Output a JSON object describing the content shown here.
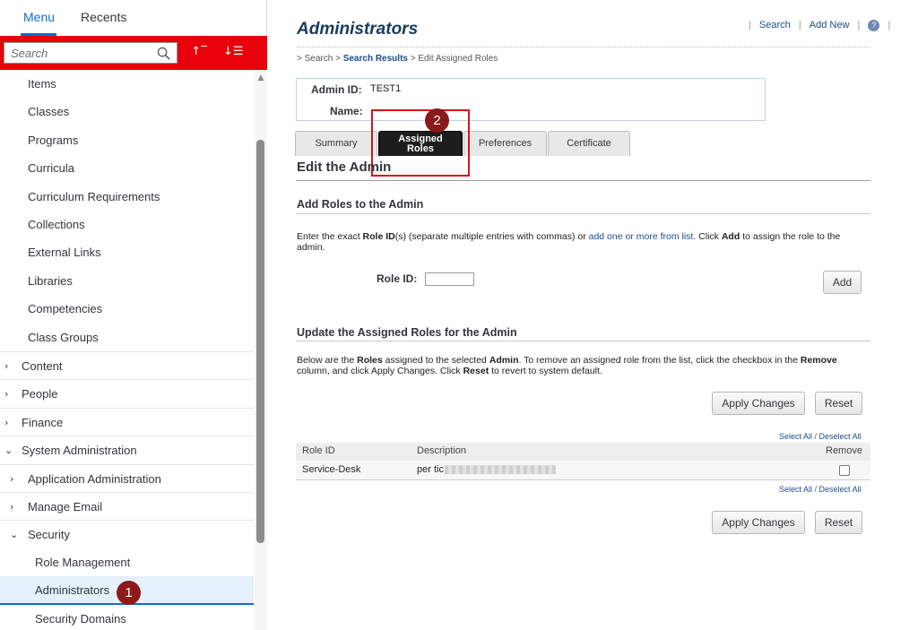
{
  "sidebar": {
    "tabs": [
      {
        "label": "Menu"
      },
      {
        "label": "Recents"
      }
    ],
    "search": {
      "placeholder": "Search",
      "value": ""
    },
    "tools": {
      "collapse_icon": "↑‾",
      "sort_icon": "↓☰"
    },
    "items": [
      {
        "label": "Items"
      },
      {
        "label": "Classes"
      },
      {
        "label": "Programs"
      },
      {
        "label": "Curricula"
      },
      {
        "label": "Curriculum Requirements"
      },
      {
        "label": "Collections"
      },
      {
        "label": "External Links"
      },
      {
        "label": "Libraries"
      },
      {
        "label": "Competencies"
      },
      {
        "label": "Class Groups"
      },
      {
        "label": "Content"
      },
      {
        "label": "People"
      },
      {
        "label": "Finance"
      },
      {
        "label": "System Administration"
      },
      {
        "label": "Application Administration"
      },
      {
        "label": "Manage Email"
      },
      {
        "label": "Security"
      },
      {
        "label": "Role Management"
      },
      {
        "label": "Administrators"
      },
      {
        "label": "Security Domains"
      }
    ],
    "chevron_right": "›",
    "chevron_down": "⌄",
    "scroll_up_glyph": "▲"
  },
  "badges": {
    "one": "1",
    "two": "2"
  },
  "header": {
    "title": "Administrators",
    "links": {
      "search": "Search",
      "add_new": "Add New",
      "help": "?",
      "sep": "|"
    }
  },
  "breadcrumb": {
    "prefix": "> Search > ",
    "results": "Search Results",
    "suffix": " > Edit Assigned Roles"
  },
  "admin": {
    "id_label": "Admin ID:",
    "id_value": "TEST1",
    "name_label": "Name:",
    "name_value": ""
  },
  "tabs": [
    {
      "label": "Summary"
    },
    {
      "label": "Assigned Roles"
    },
    {
      "label": "Preferences"
    },
    {
      "label": "Certificate"
    }
  ],
  "tab_assigned_line1": "Assigned",
  "tab_assigned_line2": "Roles",
  "edit_title": "Edit the Admin",
  "add_section": {
    "title": "Add Roles to the Admin",
    "text_1": "Enter the exact ",
    "text_role_id": "Role ID",
    "text_2": "(s) (separate multiple entries with commas) or ",
    "link": "add one or more from list",
    "text_3": ". Click ",
    "text_add": "Add",
    "text_4": " to assign the role to the admin.",
    "role_label": "Role ID:",
    "role_value": "",
    "add_button": "Add"
  },
  "update_section": {
    "title": "Update the Assigned Roles for the Admin",
    "t1": "Below are the ",
    "t_roles": "Roles",
    "t2": " assigned to the selected ",
    "t_admin": "Admin",
    "t3": ". To remove an assigned role from the list, click the checkbox in the ",
    "t_remove": "Remove",
    "t4": " column, and click Apply Changes. Click ",
    "t_reset": "Reset",
    "t5": " to revert to system default.",
    "apply_button": "Apply Changes",
    "reset_button": "Reset",
    "select_all": "Select All",
    "deselect_all": "Deselect All",
    "slash": " / "
  },
  "table": {
    "headers": {
      "role_id": "Role ID",
      "description": "Description",
      "remove": "Remove"
    },
    "rows": [
      {
        "role_id": "Service-Desk",
        "description": "per tic"
      }
    ]
  }
}
